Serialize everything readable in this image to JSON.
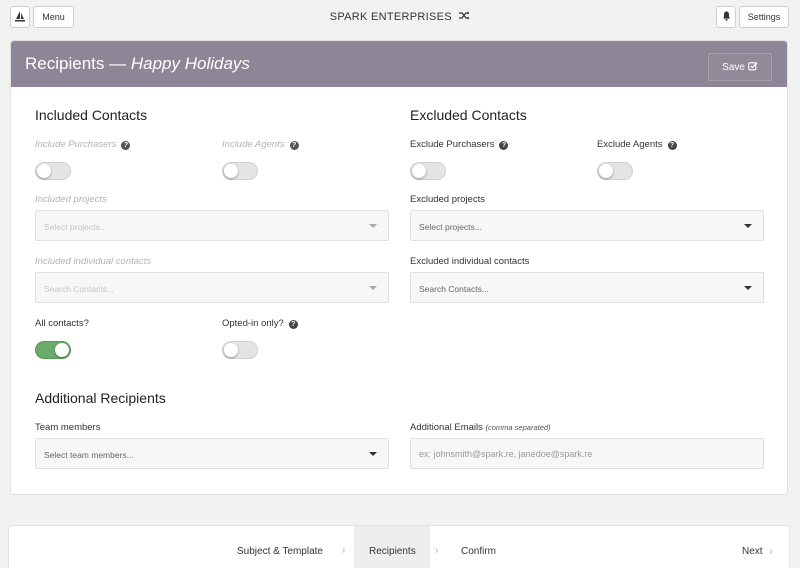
{
  "topbar": {
    "logo_icon": "sail-icon",
    "menu_label": "Menu",
    "brand": "SPARK ENTERPRISES",
    "brand_icon": "shuffle-icon",
    "bell_icon": "bell-icon",
    "settings_label": "Settings"
  },
  "panel": {
    "title": "Recipients —",
    "title_sub": "Happy Holidays",
    "save_label": "Save",
    "header_color": "#8e8596"
  },
  "included": {
    "heading": "Included Contacts",
    "include_purchasers": "Include Purchasers",
    "include_agents": "Include Agents",
    "projects_label": "Included projects",
    "projects_placeholder": "Select projects...",
    "contacts_label": "Included individual contacts",
    "contacts_placeholder": "Search Contacts...",
    "all_contacts": "All contacts?",
    "opted_in": "Opted-in only?"
  },
  "excluded": {
    "heading": "Excluded Contacts",
    "exclude_purchasers": "Exclude Purchasers",
    "exclude_agents": "Exclude Agents",
    "projects_label": "Excluded projects",
    "projects_placeholder": "Select projects...",
    "contacts_label": "Excluded individual contacts",
    "contacts_placeholder": "Search Contacts..."
  },
  "toggles": {
    "include_purchasers": false,
    "include_agents": false,
    "exclude_purchasers": false,
    "exclude_agents": false,
    "all_contacts": true,
    "opted_in": false,
    "on_color": "#6aaa6b"
  },
  "additional": {
    "heading": "Additional Recipients",
    "team_label": "Team members",
    "team_placeholder": "Select team members...",
    "emails_label": "Additional Emails",
    "emails_note": "(comma separated)",
    "emails_placeholder": "ex: johnsmith@spark.re, janedoe@spark.re"
  },
  "wizard": {
    "steps": [
      "Subject & Template",
      "Recipients",
      "Confirm"
    ],
    "active_step": "Recipients",
    "next_label": "Next"
  }
}
